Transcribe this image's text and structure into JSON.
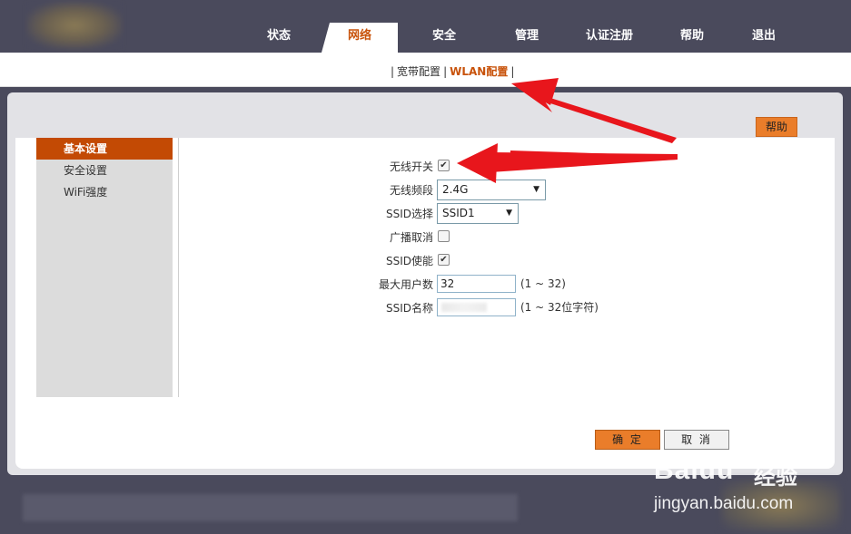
{
  "nav": {
    "tabs": [
      {
        "label": "状态"
      },
      {
        "label": "网络"
      },
      {
        "label": "安全"
      },
      {
        "label": "管理"
      },
      {
        "label": "认证注册"
      },
      {
        "label": "帮助"
      },
      {
        "label": "退出"
      }
    ],
    "active": "网络"
  },
  "subnav": {
    "items": [
      "宽带配置",
      "WLAN配置"
    ],
    "active": "WLAN配置",
    "separator": "|"
  },
  "help_button": "帮助",
  "sidebar": {
    "items": [
      {
        "label": "基本设置"
      },
      {
        "label": "安全设置"
      },
      {
        "label": "WiFi强度"
      }
    ],
    "active": "基本设置"
  },
  "form": {
    "wireless_switch": {
      "label": "无线开关",
      "checked": true
    },
    "band": {
      "label": "无线频段",
      "value": "2.4G"
    },
    "ssid_select": {
      "label": "SSID选择",
      "value": "SSID1"
    },
    "broadcast_cancel": {
      "label": "广播取消",
      "checked": false
    },
    "ssid_enable": {
      "label": "SSID使能",
      "checked": true
    },
    "max_users": {
      "label": "最大用户数",
      "value": "32",
      "hint": "(1 ~ 32)"
    },
    "ssid_name": {
      "label": "SSID名称",
      "value": "",
      "hint": "(1 ~ 32位字符)"
    }
  },
  "buttons": {
    "ok": "确 定",
    "cancel": "取 消"
  },
  "watermark": {
    "logo": "Baidu",
    "text": "经验",
    "url": "jingyan.baidu.com"
  },
  "colors": {
    "accent": "#c8520a",
    "button_orange": "#ea7d2a",
    "header_bg": "#4a4a5c",
    "annotation_red": "#e8161c"
  }
}
